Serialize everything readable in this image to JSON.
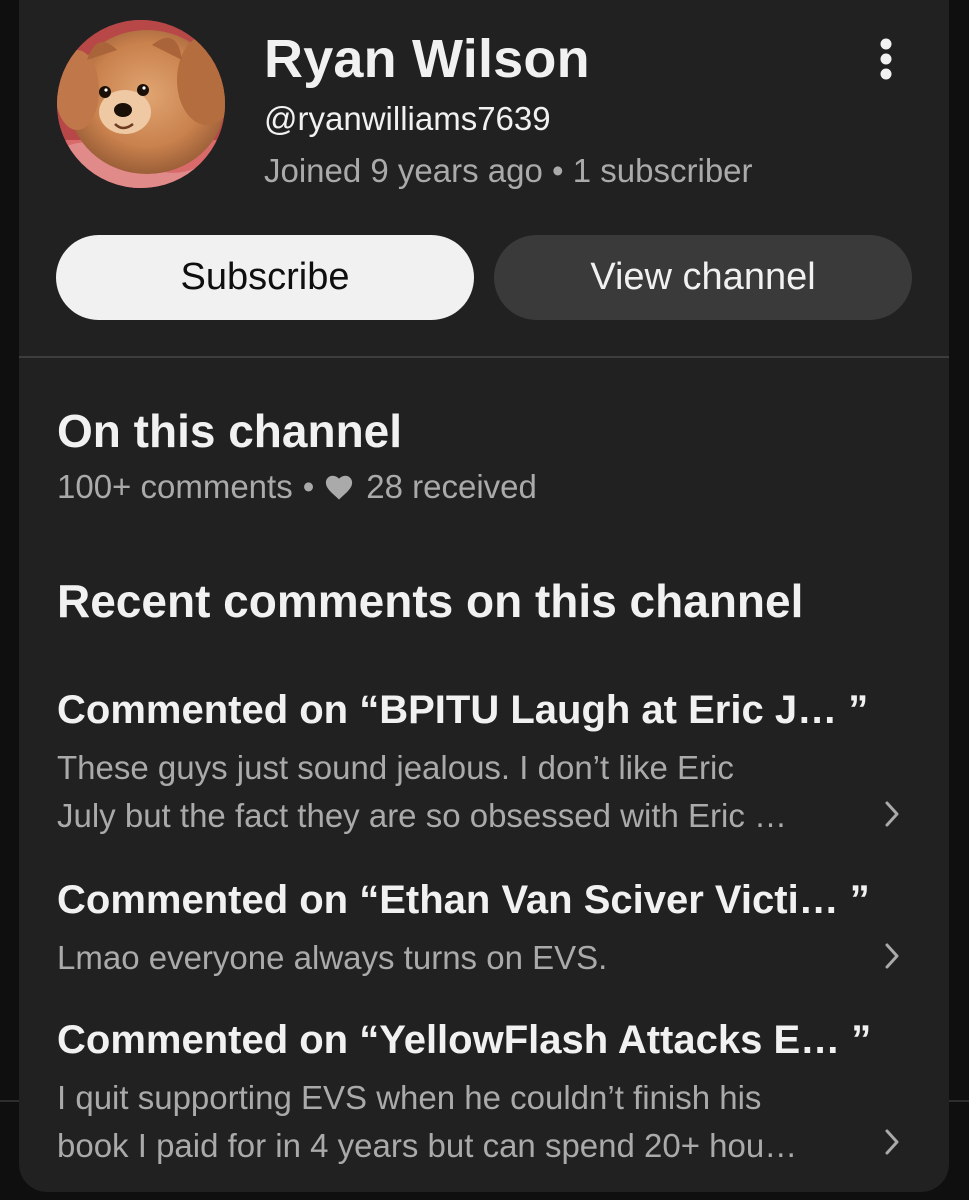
{
  "profile": {
    "name": "Ryan Wilson",
    "handle": "@ryanwilliams7639",
    "joined": "Joined 9 years ago",
    "separator": "•",
    "subscribers": "1 subscriber",
    "avatar_icon": "dog-photo-avatar",
    "more_icon": "vertical-ellipsis-icon"
  },
  "actions": {
    "subscribe_label": "Subscribe",
    "view_channel_label": "View channel"
  },
  "on_channel": {
    "title": "On this channel",
    "comments_count": "100+ comments",
    "separator": "•",
    "heart_icon": "heart-icon",
    "received": "28 received"
  },
  "recent": {
    "title": "Recent comments on this channel",
    "chevron_icon": "chevron-right-icon",
    "items": [
      {
        "heading": "Commented on “BPITU Laugh at Eric J… ”",
        "lines": [
          "These guys just sound jealous. I don’t like Eric",
          "July but the fact they are so obsessed with Eric …"
        ]
      },
      {
        "heading": "Commented on “Ethan Van Sciver Victi… ”",
        "lines": [
          "Lmao everyone always turns on EVS."
        ]
      },
      {
        "heading": "Commented on “YellowFlash Attacks E… ”",
        "lines": [
          "I quit supporting EVS when he couldn’t finish his",
          "book I paid for in 4 years but can spend 20+ hou…"
        ]
      }
    ]
  },
  "colors": {
    "sheet_bg": "#212121",
    "page_bg": "#0f0f0f",
    "primary_text": "#f1f1f1",
    "secondary_text": "#aaaaaa",
    "subscribe_bg": "#f1f1f1",
    "view_channel_bg": "#3a3a3a"
  }
}
